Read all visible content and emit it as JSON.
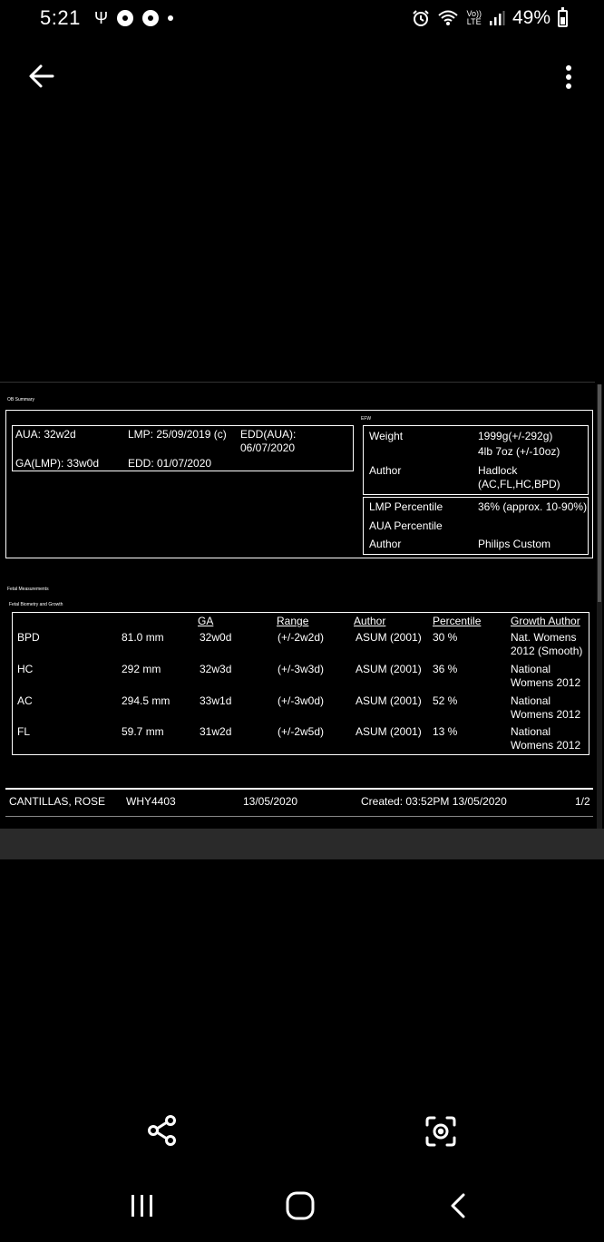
{
  "status_bar": {
    "time": "5:21",
    "usb_glyph": "Ψ",
    "volte_line1": "Vo))",
    "volte_line2": "LTE",
    "battery": "49%"
  },
  "report": {
    "ob_summary_title": "OB Summary",
    "efw_title": "EFW",
    "aua": "AUA: 32w2d",
    "lmp": "LMP: 25/09/2019 (c)",
    "edd_aua_label": "EDD(AUA):",
    "edd_aua_value": "06/07/2020",
    "ga_lmp": "GA(LMP): 33w0d",
    "edd": "EDD: 01/07/2020",
    "weight_label": "Weight",
    "weight_value1": "1999g(+/-292g)",
    "weight_value2": "4lb 7oz (+/-10oz)",
    "efw_author_label": "Author",
    "efw_author_value1": "Hadlock",
    "efw_author_value2": "(AC,FL,HC,BPD)",
    "lmp_percentile_label": "LMP Percentile",
    "lmp_percentile_value": "36% (approx. 10-90%)",
    "aua_percentile_label": "AUA Percentile",
    "pct_author_label": "Author",
    "pct_author_value": "Philips Custom",
    "fetal_measurements_title": "Fetal Measurements",
    "fetal_biometry_title": "Fetal Biometry and Growth",
    "columns": [
      "GA",
      "Range",
      "Author",
      "Percentile",
      "Growth Author"
    ],
    "rows": [
      {
        "name": "BPD",
        "value": "81.0 mm",
        "ga": "32w0d",
        "range": "(+/-2w2d)",
        "author": "ASUM (2001)",
        "percentile": "30 %",
        "growth1": "Nat. Womens",
        "growth2": "2012 (Smooth)"
      },
      {
        "name": "HC",
        "value": "292 mm",
        "ga": "32w3d",
        "range": "(+/-3w3d)",
        "author": "ASUM (2001)",
        "percentile": "36 %",
        "growth1": "National",
        "growth2": "Womens 2012"
      },
      {
        "name": "AC",
        "value": "294.5 mm",
        "ga": "33w1d",
        "range": "(+/-3w0d)",
        "author": "ASUM (2001)",
        "percentile": "52 %",
        "growth1": "National",
        "growth2": "Womens 2012"
      },
      {
        "name": "FL",
        "value": "59.7 mm",
        "ga": "31w2d",
        "range": "(+/-2w5d)",
        "author": "ASUM (2001)",
        "percentile": "13 %",
        "growth1": "National",
        "growth2": "Womens 2012"
      }
    ],
    "footer": {
      "patient": "CANTILLAS, ROSE",
      "id": "WHY4403",
      "date": "13/05/2020",
      "created": "Created: 03:52PM 13/05/2020",
      "page": "1/2"
    }
  },
  "icons": {
    "back": "back-arrow-icon",
    "more": "more-vertical-icon",
    "share": "share-icon",
    "lens": "lens-scan-icon",
    "recents": "recents-icon",
    "home": "home-icon",
    "nav_back": "nav-back-icon"
  }
}
